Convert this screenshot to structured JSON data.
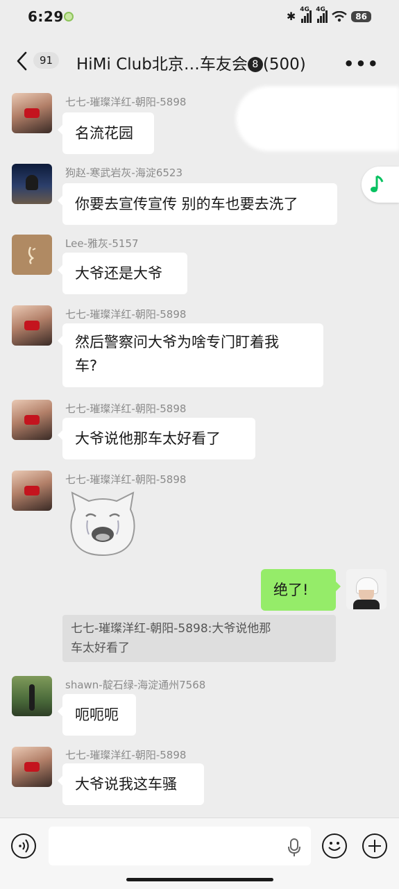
{
  "status_bar": {
    "time": "6:29",
    "network_1": "4G",
    "network_2": "4G",
    "battery": "86"
  },
  "header": {
    "unread_count": "91",
    "title": "HiMi Club北京…车友会",
    "badge": "8",
    "member_count": "(500)"
  },
  "messages": [
    {
      "sender": "七七-璀璨洋红-朝阳-5898",
      "text": "名流花园"
    },
    {
      "sender": "狗赵-寒武岩灰-海淀6523",
      "text": "你要去宣传宣传 别的车也要去洗了"
    },
    {
      "sender": "Lee-雅灰-5157",
      "text": "大爷还是大爷"
    },
    {
      "sender": "七七-璀璨洋红-朝阳-5898",
      "text_line1": "然后警察问大爷为啥专门盯着我",
      "text_line2": "车?"
    },
    {
      "sender": "七七-璀璨洋红-朝阳-5898",
      "text": "大爷说他那车太好看了"
    },
    {
      "sender": "七七-璀璨洋红-朝阳-5898",
      "sticker": "crying-cat-sticker"
    },
    {
      "self": true,
      "text": "绝了!"
    },
    {
      "quote_line1": "七七-璀璨洋红-朝阳-5898:大爷说他那",
      "quote_line2": "车太好看了"
    },
    {
      "sender": "shawn-靛石绿-海淀通州7568",
      "text": "呃呃呃"
    },
    {
      "sender": "七七-璀璨洋红-朝阳-5898",
      "text": "大爷说我这车骚"
    }
  ],
  "input_bar": {
    "value": "",
    "icons": [
      "voice-icon",
      "mic-icon",
      "emoji-icon",
      "plus-icon"
    ]
  },
  "colors": {
    "background": "#ededed",
    "self_bubble": "#95ec69",
    "other_bubble": "#ffffff",
    "music_accent": "#07c160"
  }
}
